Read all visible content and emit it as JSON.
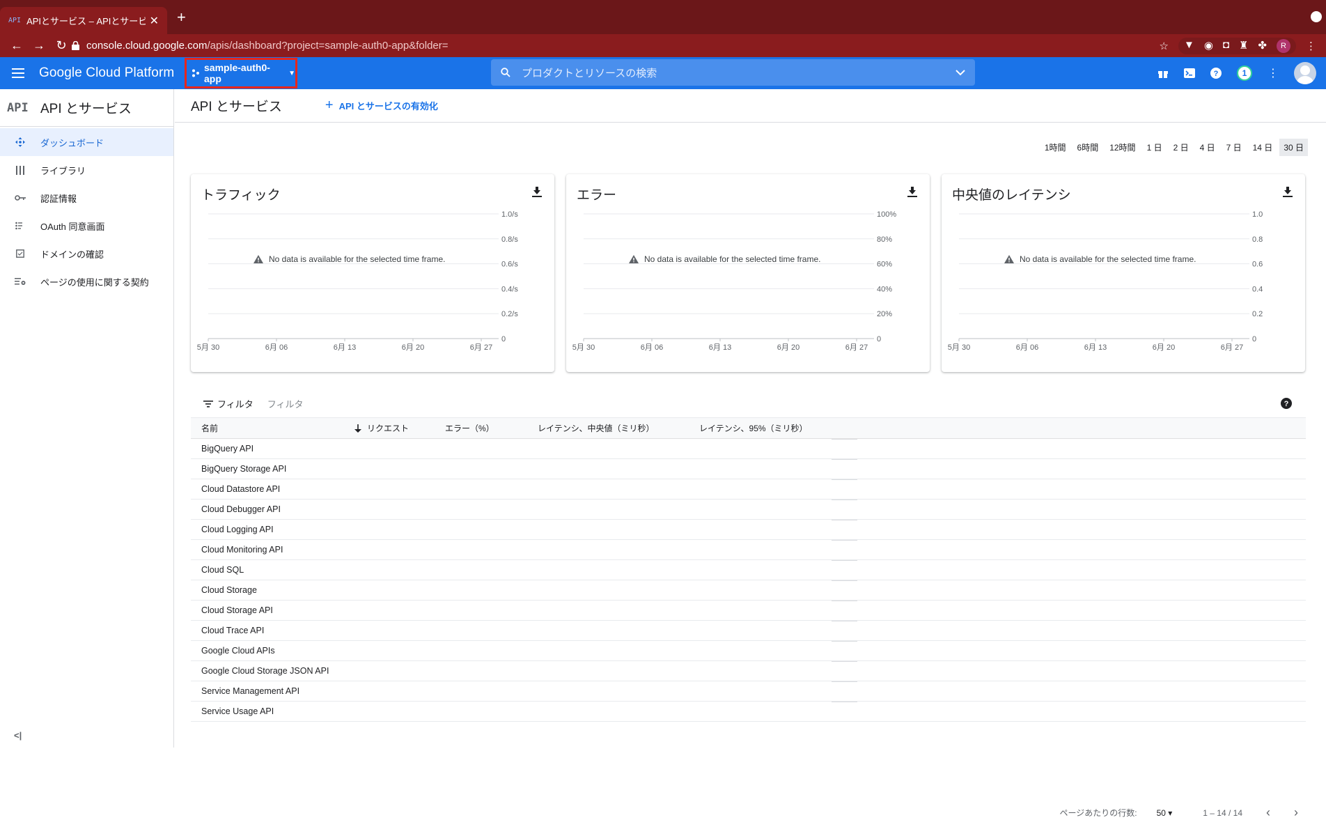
{
  "browser": {
    "tab_title": "APIとサービス – APIとサービス",
    "tab_favicon": "API",
    "url_host": "console.cloud.google.com",
    "url_path": "/apis/dashboard?project=sample-auth0-app&folder=",
    "profile_initial": "R"
  },
  "header": {
    "brand": "Google Cloud Platform",
    "project": "sample-auth0-app",
    "search_placeholder": "プロダクトとリソースの検索",
    "notifications": "1"
  },
  "sidebar": {
    "api_icon": "API",
    "title": "API とサービス",
    "items": [
      {
        "label": "ダッシュボード",
        "icon": "dashboard-icon"
      },
      {
        "label": "ライブラリ",
        "icon": "library-icon"
      },
      {
        "label": "認証情報",
        "icon": "key-icon"
      },
      {
        "label": "OAuth 同意画面",
        "icon": "consent-icon"
      },
      {
        "label": "ドメインの確認",
        "icon": "checkbox-icon"
      },
      {
        "label": "ページの使用に関する契約",
        "icon": "settings-list-icon"
      }
    ],
    "collapse": "<|"
  },
  "main": {
    "title": "API とサービス",
    "enable_label": "API とサービスの有効化",
    "ranges": [
      "1時間",
      "6時間",
      "12時間",
      "1 日",
      "2 日",
      "4 日",
      "7 日",
      "14 日",
      "30 日"
    ],
    "selected_range": "30 日"
  },
  "chart_data": [
    {
      "type": "line",
      "title": "トラフィック",
      "x": [
        "5月 30",
        "6月 06",
        "6月 13",
        "6月 20",
        "6月 27"
      ],
      "y_ticks": [
        "1.0/s",
        "0.8/s",
        "0.6/s",
        "0.4/s",
        "0.2/s",
        "0"
      ],
      "series": [],
      "message": "No data is available for the selected time frame."
    },
    {
      "type": "line",
      "title": "エラー",
      "x": [
        "5月 30",
        "6月 06",
        "6月 13",
        "6月 20",
        "6月 27"
      ],
      "y_ticks": [
        "100%",
        "80%",
        "60%",
        "40%",
        "20%",
        "0"
      ],
      "series": [],
      "message": "No data is available for the selected time frame."
    },
    {
      "type": "line",
      "title": "中央値のレイテンシ",
      "x": [
        "5月 30",
        "6月 06",
        "6月 13",
        "6月 20",
        "6月 27"
      ],
      "y_ticks": [
        "1.0",
        "0.8",
        "0.6",
        "0.4",
        "0.2",
        "0"
      ],
      "series": [],
      "message": "No data is available for the selected time frame."
    }
  ],
  "table": {
    "filter_label": "フィルタ",
    "filter_placeholder": "フィルタ",
    "columns": [
      "名前",
      "リクエスト",
      "エラー（%）",
      "レイテンシ、中央値（ミリ秒）",
      "レイテンシ、95%（ミリ秒）"
    ],
    "rows": [
      "BigQuery API",
      "BigQuery Storage API",
      "Cloud Datastore API",
      "Cloud Debugger API",
      "Cloud Logging API",
      "Cloud Monitoring API",
      "Cloud SQL",
      "Cloud Storage",
      "Cloud Storage API",
      "Cloud Trace API",
      "Google Cloud APIs",
      "Google Cloud Storage JSON API",
      "Service Management API",
      "Service Usage API"
    ],
    "rows_per_page_label": "ページあたりの行数:",
    "rows_per_page": "50",
    "range": "1 – 14 / 14"
  }
}
